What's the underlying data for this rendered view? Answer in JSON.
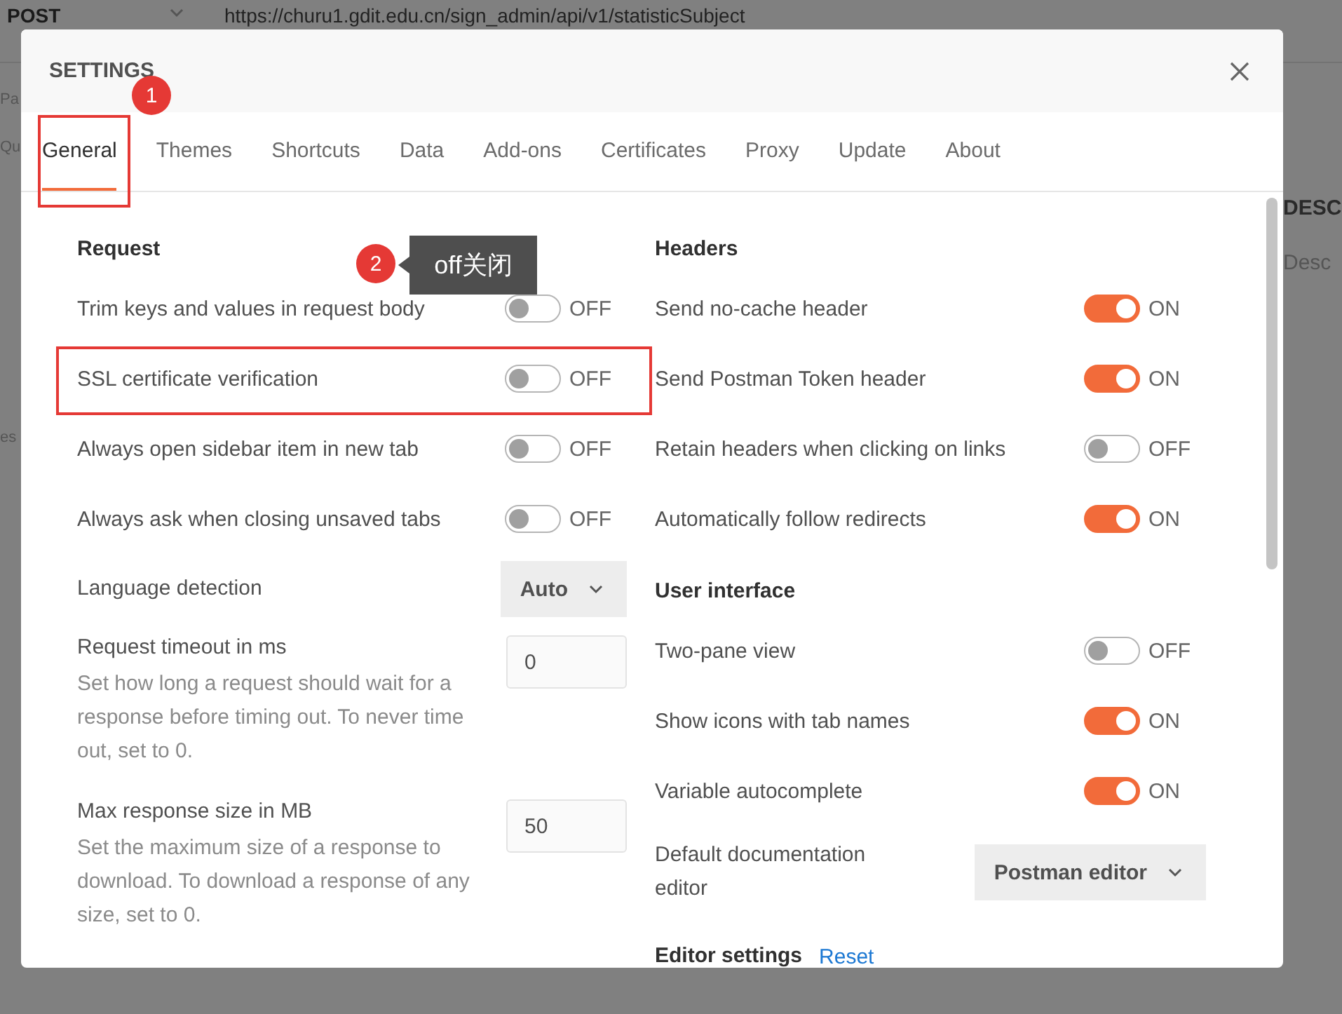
{
  "background": {
    "method": "POST",
    "url": "https://churu1.gdit.edu.cn/sign_admin/api/v1/statisticSubject",
    "left_texts": [
      "Pa",
      "Qu",
      "es"
    ],
    "right_texts": [
      "DESC",
      "Desc"
    ]
  },
  "dialog": {
    "title": "SETTINGS",
    "tabs": [
      {
        "label": "General",
        "selected": true,
        "highlighted": true,
        "callout": "1"
      },
      {
        "label": "Themes",
        "selected": false,
        "highlighted": false
      },
      {
        "label": "Shortcuts",
        "selected": false,
        "highlighted": false
      },
      {
        "label": "Data",
        "selected": false,
        "highlighted": false
      },
      {
        "label": "Add-ons",
        "selected": false,
        "highlighted": false
      },
      {
        "label": "Certificates",
        "selected": false,
        "highlighted": false
      },
      {
        "label": "Proxy",
        "selected": false,
        "highlighted": false
      },
      {
        "label": "Update",
        "selected": false,
        "highlighted": false
      },
      {
        "label": "About",
        "selected": false,
        "highlighted": false
      }
    ],
    "callout": {
      "number": "2",
      "tooltip": "off关闭"
    },
    "columns": [
      [
        {
          "title": "Request",
          "rows": [
            {
              "kind": "toggle",
              "label": "Trim keys and values in request body",
              "on": false,
              "state_label": "OFF",
              "highlighted": false
            },
            {
              "kind": "toggle",
              "label": "SSL certificate verification",
              "on": false,
              "state_label": "OFF",
              "highlighted": true
            },
            {
              "kind": "toggle",
              "label": "Always open sidebar item in new tab",
              "on": false,
              "state_label": "OFF",
              "highlighted": false
            },
            {
              "kind": "toggle",
              "label": "Always ask when closing unsaved tabs",
              "on": false,
              "state_label": "OFF",
              "highlighted": false
            },
            {
              "kind": "select",
              "label": "Language detection",
              "value": "Auto",
              "highlighted": false
            },
            {
              "kind": "number",
              "label": "Request timeout in ms",
              "value": "0",
              "description": "Set how long a request should wait for a response before timing out. To never time out, set to 0.",
              "highlighted": false
            },
            {
              "kind": "number",
              "label": "Max response size in MB",
              "value": "50",
              "description": "Set the maximum size of a response to download. To download a response of any size, set to 0.",
              "highlighted": false
            }
          ]
        }
      ],
      [
        {
          "title": "Headers",
          "rows": [
            {
              "kind": "toggle",
              "label": "Send no-cache header",
              "on": true,
              "state_label": "ON",
              "highlighted": false
            },
            {
              "kind": "toggle",
              "label": "Send Postman Token header",
              "on": true,
              "state_label": "ON",
              "highlighted": false
            },
            {
              "kind": "toggle",
              "label": "Retain headers when clicking on links",
              "on": false,
              "state_label": "OFF",
              "highlighted": false
            },
            {
              "kind": "toggle",
              "label": "Automatically follow redirects",
              "on": true,
              "state_label": "ON",
              "highlighted": false
            }
          ]
        },
        {
          "title": "User interface",
          "rows": [
            {
              "kind": "toggle",
              "label": "Two-pane view",
              "on": false,
              "state_label": "OFF",
              "highlighted": false
            },
            {
              "kind": "toggle",
              "label": "Show icons with tab names",
              "on": true,
              "state_label": "ON",
              "highlighted": false
            },
            {
              "kind": "toggle",
              "label": "Variable autocomplete",
              "on": true,
              "state_label": "ON",
              "highlighted": false
            },
            {
              "kind": "select",
              "label": "Default documentation editor",
              "value": "Postman editor",
              "highlighted": false
            }
          ]
        },
        {
          "title": "Editor settings",
          "link": "Reset"
        }
      ]
    ]
  }
}
